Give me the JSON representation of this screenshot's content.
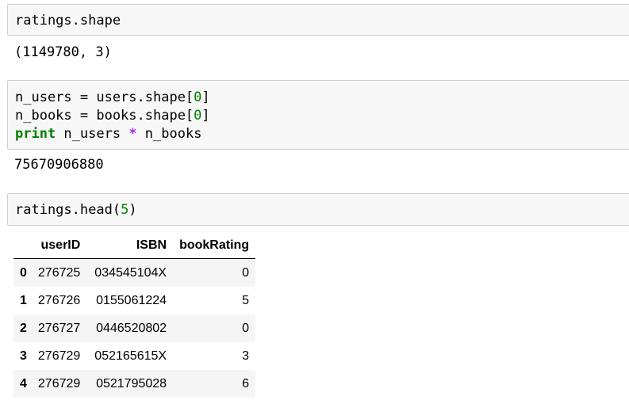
{
  "cells": [
    {
      "input": "ratings.shape",
      "output": "(1149780, 3)"
    },
    {
      "output": "75670906880"
    },
    {
      "output_table": true
    }
  ],
  "cell2": {
    "line1_a": "n_users = users.shape[",
    "line1_num": "0",
    "line1_b": "]",
    "line2_a": "n_books = books.shape[",
    "line2_num": "0",
    "line2_b": "]",
    "line3_kw": "print",
    "line3_a": " n_users ",
    "line3_op": "*",
    "line3_b": " n_books"
  },
  "cell3": {
    "input_a": "ratings.head(",
    "input_num": "5",
    "input_b": ")"
  },
  "table": {
    "columns": [
      "",
      "userID",
      "ISBN",
      "bookRating"
    ],
    "rows": [
      {
        "index": "0",
        "userID": "276725",
        "ISBN": "034545104X",
        "bookRating": "0"
      },
      {
        "index": "1",
        "userID": "276726",
        "ISBN": "0155061224",
        "bookRating": "5"
      },
      {
        "index": "2",
        "userID": "276727",
        "ISBN": "0446520802",
        "bookRating": "0"
      },
      {
        "index": "3",
        "userID": "276729",
        "ISBN": "052165615X",
        "bookRating": "3"
      },
      {
        "index": "4",
        "userID": "276729",
        "ISBN": "0521795028",
        "bookRating": "6"
      }
    ]
  }
}
